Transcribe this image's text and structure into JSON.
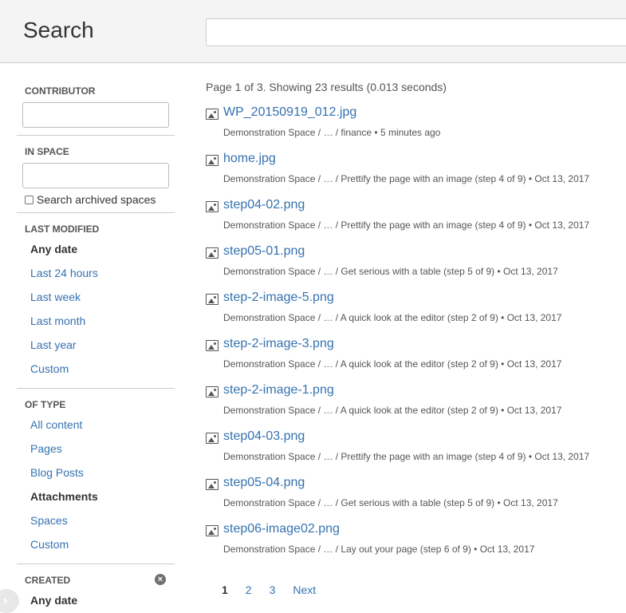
{
  "header": {
    "title": "Search",
    "search_value": ""
  },
  "sidebar": {
    "contributor": {
      "label": "CONTRIBUTOR",
      "value": ""
    },
    "in_space": {
      "label": "IN SPACE",
      "value": "",
      "archived_label": "Search archived spaces"
    },
    "last_modified": {
      "label": "LAST MODIFIED",
      "options": [
        "Any date",
        "Last 24 hours",
        "Last week",
        "Last month",
        "Last year",
        "Custom"
      ]
    },
    "of_type": {
      "label": "OF TYPE",
      "options": [
        "All content",
        "Pages",
        "Blog Posts",
        "Attachments",
        "Spaces",
        "Custom"
      ]
    },
    "created": {
      "label": "CREATED",
      "options": [
        "Any date"
      ]
    }
  },
  "main": {
    "summary": "Page 1 of 3. Showing 23 results (0.013 seconds)",
    "results": [
      {
        "title": "WP_20150919_012.jpg",
        "meta": "Demonstration Space / … / finance • 5 minutes ago"
      },
      {
        "title": "home.jpg",
        "meta": "Demonstration Space / … / Prettify the page with an image (step 4 of 9) • Oct 13, 2017"
      },
      {
        "title": "step04-02.png",
        "meta": "Demonstration Space / … / Prettify the page with an image (step 4 of 9) • Oct 13, 2017"
      },
      {
        "title": "step05-01.png",
        "meta": "Demonstration Space / … / Get serious with a table (step 5 of 9) • Oct 13, 2017"
      },
      {
        "title": "step-2-image-5.png",
        "meta": "Demonstration Space / … / A quick look at the editor (step 2 of 9) • Oct 13, 2017"
      },
      {
        "title": "step-2-image-3.png",
        "meta": "Demonstration Space / … / A quick look at the editor (step 2 of 9) • Oct 13, 2017"
      },
      {
        "title": "step-2-image-1.png",
        "meta": "Demonstration Space / … / A quick look at the editor (step 2 of 9) • Oct 13, 2017"
      },
      {
        "title": "step04-03.png",
        "meta": "Demonstration Space / … / Prettify the page with an image (step 4 of 9) • Oct 13, 2017"
      },
      {
        "title": "step05-04.png",
        "meta": "Demonstration Space / … / Get serious with a table (step 5 of 9) • Oct 13, 2017"
      },
      {
        "title": "step06-image02.png",
        "meta": "Demonstration Space / … / Lay out your page (step 6 of 9) • Oct 13, 2017"
      }
    ],
    "pager": [
      "1",
      "2",
      "3",
      "Next"
    ]
  },
  "colors": {
    "link": "#3572b0",
    "text": "#333333",
    "header_bg": "#f4f4f4"
  },
  "icons": {
    "result": "image-file-icon",
    "clear": "clear-filter-icon",
    "expand": "chevron-right-icon"
  }
}
